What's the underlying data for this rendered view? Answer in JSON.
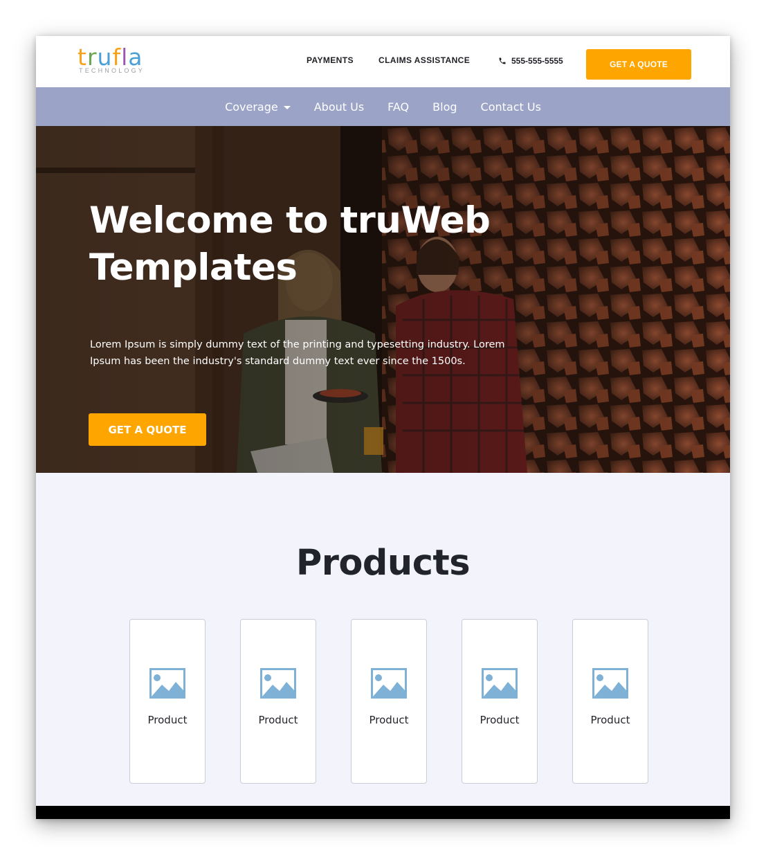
{
  "header": {
    "logo_text": "trufla",
    "logo_subtext": "TECHNOLOGY",
    "links": [
      {
        "label": "PAYMENTS"
      },
      {
        "label": "CLAIMS ASSISTANCE"
      }
    ],
    "phone": "555-555-5555",
    "phone_icon": "phone-icon",
    "cta_label": "GET A QUOTE",
    "cta_color": "#ffa500"
  },
  "nav": {
    "background": "#9ba3c7",
    "items": [
      {
        "label": "Coverage",
        "has_dropdown": true
      },
      {
        "label": "About Us"
      },
      {
        "label": "FAQ"
      },
      {
        "label": "Blog"
      },
      {
        "label": "Contact Us"
      }
    ]
  },
  "hero": {
    "title": "Welcome to truWeb Templates",
    "text": "Lorem Ipsum is simply dummy text of the printing and typesetting industry. Lorem Ipsum has been the industry's standard dummy text ever since the 1500s.",
    "cta_label": "GET A QUOTE"
  },
  "products": {
    "title": "Products",
    "items": [
      {
        "label": "Product",
        "icon": "image-placeholder-icon"
      },
      {
        "label": "Product",
        "icon": "image-placeholder-icon"
      },
      {
        "label": "Product",
        "icon": "image-placeholder-icon"
      },
      {
        "label": "Product",
        "icon": "image-placeholder-icon"
      },
      {
        "label": "Product",
        "icon": "image-placeholder-icon"
      }
    ]
  }
}
